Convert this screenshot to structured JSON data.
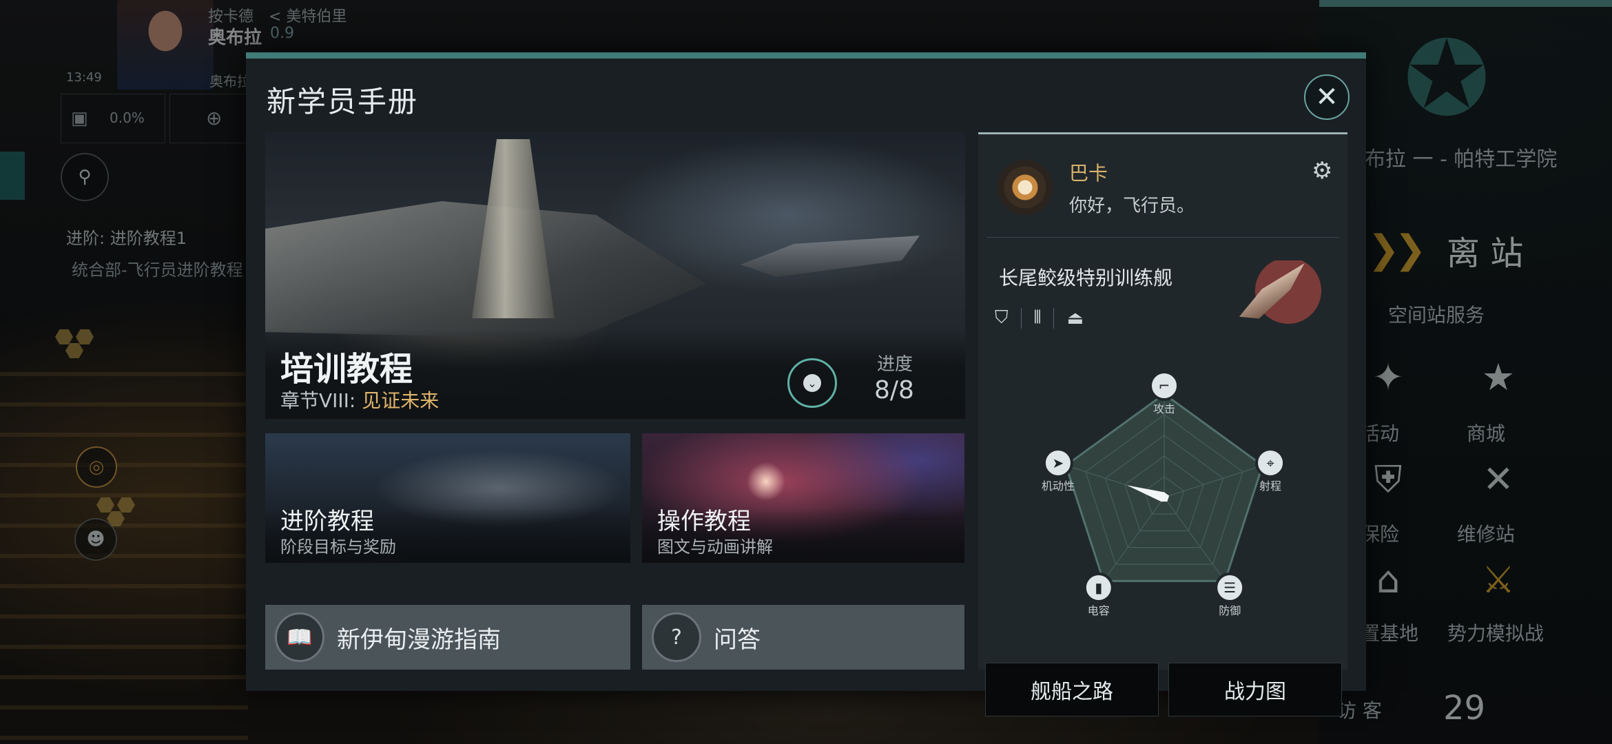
{
  "background": {
    "hud": {
      "location_small": "按卡德",
      "back_label": "< 美特伯里",
      "system_name": "奥布拉",
      "security": "0.9",
      "time": "13:49",
      "corp_short": "奥布拉",
      "cargo_percent": "0.0%",
      "mission_title": "进阶: 进阶教程1",
      "mission_sub": "统合部-飞行员进阶教程"
    },
    "right_panel": {
      "station_name": "布拉 一 - 帕特工学院",
      "undock_label": "离 站",
      "services_label": "空间站服务",
      "services": [
        "活动",
        "商城",
        "保险",
        "维修站",
        "置基地",
        "势力模拟战"
      ],
      "visitors_label": "访 客",
      "visitors_count": "29"
    }
  },
  "modal": {
    "title": "新学员手册",
    "close_icon": "close-icon",
    "hero": {
      "title": "培训教程",
      "chapter_prefix": "章节VIII: ",
      "chapter_name": "见证未来",
      "progress_label": "进度",
      "progress_current": "8",
      "progress_total": "8",
      "progress_text": "8/8"
    },
    "cards": [
      {
        "title": "进阶教程",
        "subtitle": "阶段目标与奖励"
      },
      {
        "title": "操作教程",
        "subtitle": "图文与动画讲解"
      }
    ],
    "buttons": [
      {
        "label": "新伊甸漫游指南",
        "icon": "book-icon"
      },
      {
        "label": "问答",
        "icon": "question-icon"
      }
    ],
    "ship_panel": {
      "npc_name": "巴卡",
      "npc_greeting": "你好，飞行员。",
      "ship_name": "长尾鲛级特别训练舰",
      "attribute_icons": [
        "shield-icon",
        "turret-icon",
        "hull-icon"
      ],
      "radar": {
        "axes": [
          "攻击",
          "射程",
          "防御",
          "电容",
          "机动性"
        ],
        "values": [
          0.05,
          0.05,
          0.05,
          0.05,
          0.38
        ]
      },
      "bottom_buttons": [
        "舰船之路",
        "战力图"
      ]
    }
  },
  "colors": {
    "accent_teal": "#3f7b77",
    "gold": "#e0b56a",
    "npc_gold": "#d9b36b"
  }
}
